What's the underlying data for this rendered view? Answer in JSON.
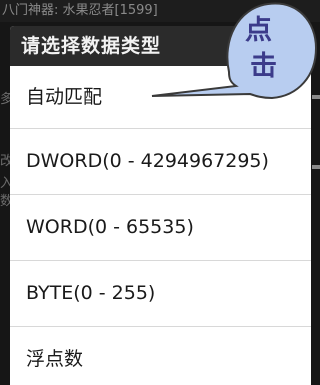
{
  "background": {
    "title": "八门神器: 水果忍者[1599]",
    "edge_chars": [
      "多",
      "改",
      "入",
      "数"
    ]
  },
  "dialog": {
    "title": "请选择数据类型",
    "options": [
      {
        "label": "自动匹配"
      },
      {
        "label": "DWORD(0 - 4294967295)"
      },
      {
        "label": "WORD(0 - 65535)"
      },
      {
        "label": "BYTE(0 - 255)"
      },
      {
        "label": "浮点数"
      }
    ]
  },
  "callout": {
    "line1": "点",
    "line2": "击",
    "fill_color": "#b8cdf0",
    "stroke_color": "#3a3a3a"
  }
}
